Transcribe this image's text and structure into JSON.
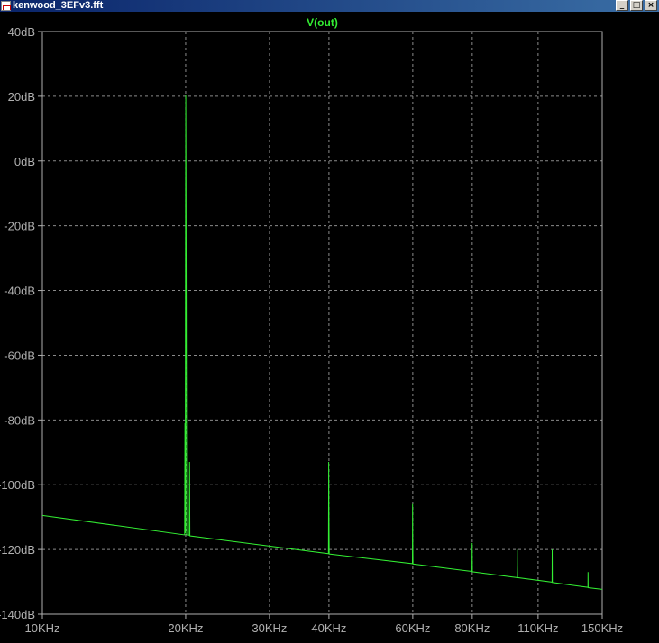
{
  "window": {
    "title": "kenwood_3EFv3.fft",
    "minimize_glyph": "_",
    "restore_glyph": "□",
    "close_glyph": "×"
  },
  "colors": {
    "background": "#000000",
    "trace": "#33ee33",
    "grid": "#8a8a8a",
    "frame": "#b0b0b0",
    "label": "#b0b0b0"
  },
  "chart_data": {
    "type": "line",
    "title": "V(out)",
    "x_scale": "log",
    "xlim": [
      10000,
      150000
    ],
    "ylim": [
      -140,
      40
    ],
    "x_ticks": [
      {
        "value": 10000,
        "label": "10KHz"
      },
      {
        "value": 20000,
        "label": "20KHz"
      },
      {
        "value": 30000,
        "label": "30KHz"
      },
      {
        "value": 40000,
        "label": "40KHz"
      },
      {
        "value": 60000,
        "label": "60KHz"
      },
      {
        "value": 80000,
        "label": "80KHz"
      },
      {
        "value": 110000,
        "label": "110KHz"
      },
      {
        "value": 150000,
        "label": "150KHz"
      }
    ],
    "y_ticks": [
      {
        "value": 40,
        "label": "40dB"
      },
      {
        "value": 20,
        "label": "20dB"
      },
      {
        "value": 0,
        "label": "0dB"
      },
      {
        "value": -20,
        "label": "-20dB"
      },
      {
        "value": -40,
        "label": "-40dB"
      },
      {
        "value": -60,
        "label": "-60dB"
      },
      {
        "value": -80,
        "label": "-80dB"
      },
      {
        "value": -100,
        "label": "-100dB"
      },
      {
        "value": -120,
        "label": "-120dB"
      },
      {
        "value": -140,
        "label": "-140dB"
      }
    ],
    "grid": true,
    "series": [
      {
        "points": [
          [
            10000,
            -109.5
          ],
          [
            19900,
            -115.5
          ],
          [
            19930,
            -81
          ],
          [
            19960,
            -115
          ],
          [
            19990,
            -14
          ],
          [
            20010,
            20.5
          ],
          [
            20030,
            -2
          ],
          [
            20060,
            -47
          ],
          [
            20090,
            -115.5
          ],
          [
            20350,
            -115.6
          ],
          [
            20380,
            -93
          ],
          [
            20410,
            -115.8
          ],
          [
            39900,
            -121.3
          ],
          [
            39950,
            -93
          ],
          [
            39990,
            -107
          ],
          [
            40050,
            -121.4
          ],
          [
            59900,
            -124.4
          ],
          [
            59950,
            -106
          ],
          [
            59990,
            -116
          ],
          [
            60060,
            -124.5
          ],
          [
            79900,
            -126.8
          ],
          [
            79960,
            -118
          ],
          [
            80050,
            -126.9
          ],
          [
            99400,
            -128.7
          ],
          [
            99450,
            -120
          ],
          [
            99500,
            -125
          ],
          [
            99600,
            -128.7
          ],
          [
            117700,
            -130.1
          ],
          [
            117760,
            -120
          ],
          [
            117850,
            -130.2
          ],
          [
            140000,
            -131.7
          ],
          [
            140060,
            -127
          ],
          [
            140150,
            -131.8
          ],
          [
            150000,
            -132.3
          ]
        ]
      }
    ]
  }
}
